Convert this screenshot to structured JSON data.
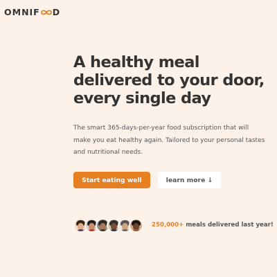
{
  "logo": {
    "text_left": "OMNIF",
    "text_right": "D"
  },
  "hero": {
    "title_lines": [
      "A healthy meal",
      "delivered to your door,",
      "every single day"
    ],
    "description_lines": [
      "The smart 365-days-per-year food subscription that will",
      "make you eat healthy again. Tailored to your personal tastes",
      "and nutritional needs."
    ],
    "primary_button": "Start eating well",
    "secondary_button": "learn more ↓"
  },
  "customers": {
    "avatar_count": 6,
    "count": "250,000+",
    "text": " meals delivered last year!"
  },
  "colors": {
    "background": "#fdf2e9",
    "accent": "#e67e22",
    "text": "#333333"
  }
}
